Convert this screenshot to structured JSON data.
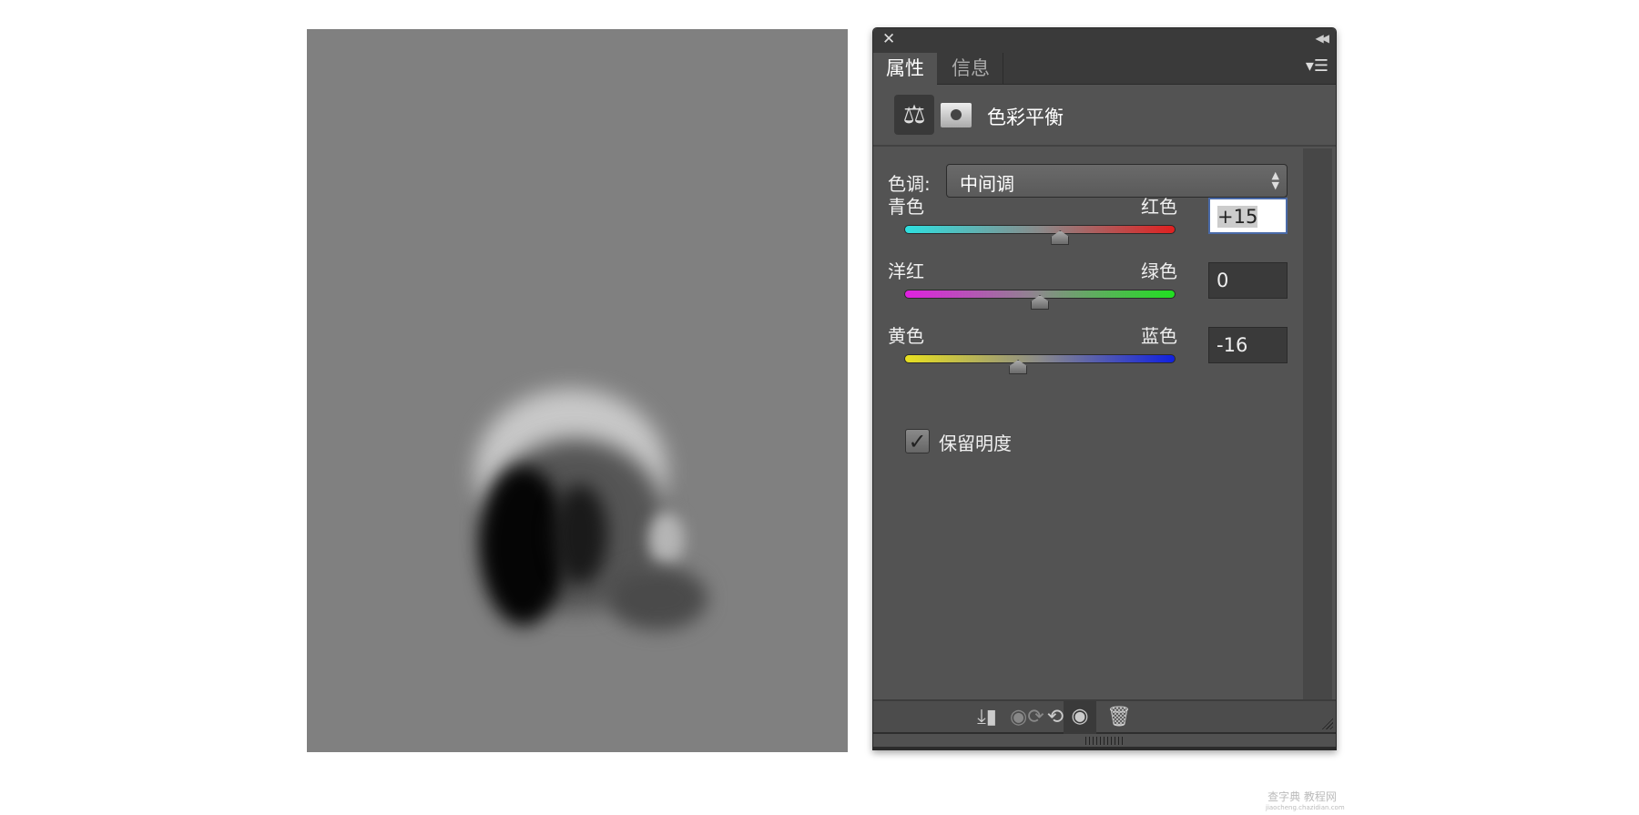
{
  "panel": {
    "tabs": [
      {
        "label": "属性",
        "active": true
      },
      {
        "label": "信息",
        "active": false
      }
    ],
    "adjustment_title": "色彩平衡",
    "tone": {
      "label": "色调:",
      "value": "中间调"
    },
    "sliders": [
      {
        "left": "青色",
        "right": "红色",
        "value": "+15",
        "number": 15,
        "min": -100,
        "max": 100,
        "colors": [
          "#2ee0e0",
          "#e02020"
        ],
        "focused": true
      },
      {
        "left": "洋红",
        "right": "绿色",
        "value": "0",
        "number": 0,
        "min": -100,
        "max": 100,
        "colors": [
          "#e020e0",
          "#20e020"
        ],
        "focused": false
      },
      {
        "left": "黄色",
        "right": "蓝色",
        "value": "-16",
        "number": -16,
        "min": -100,
        "max": 100,
        "colors": [
          "#e8e020",
          "#1020e0"
        ],
        "focused": false
      }
    ],
    "preserve_luminosity": {
      "label": "保留明度",
      "checked": true
    },
    "footer_icons": [
      "clip-to-layer-icon",
      "view-previous-state-icon",
      "reset-icon",
      "visibility-eye-icon",
      "trash-icon"
    ]
  },
  "watermark": {
    "line1": "查字典 教程网",
    "line2": "jiaocheng.chazidian.com"
  }
}
